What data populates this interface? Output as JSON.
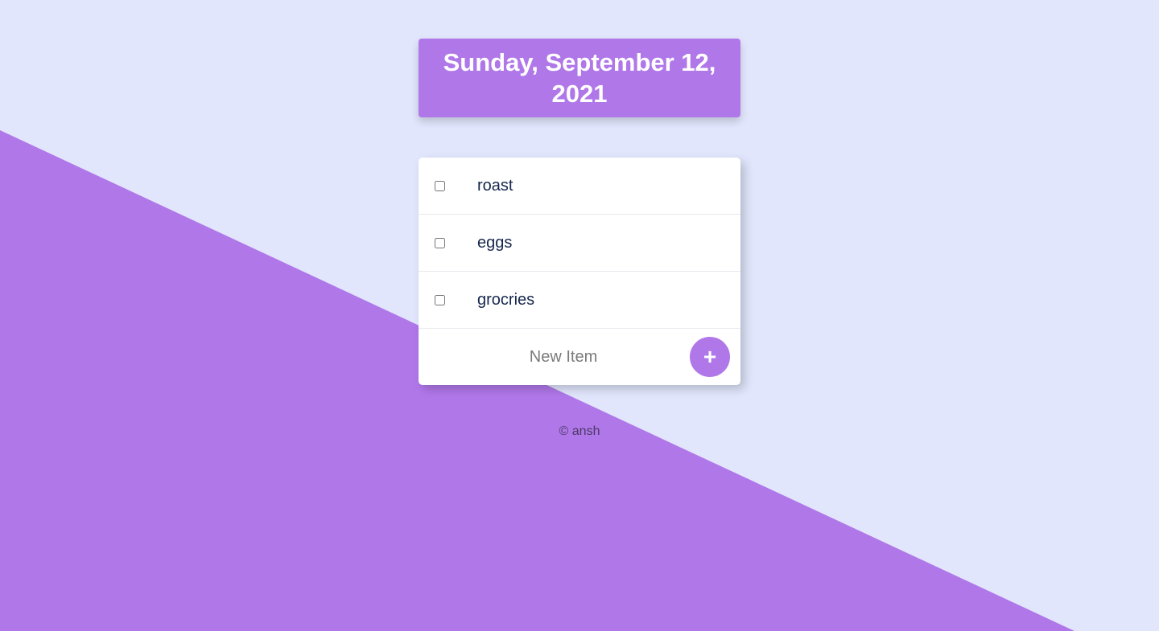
{
  "header": {
    "title": "Sunday, September 12, 2021"
  },
  "todo": {
    "items": [
      {
        "label": "roast",
        "checked": false
      },
      {
        "label": "eggs",
        "checked": false
      },
      {
        "label": "grocries",
        "checked": false
      }
    ],
    "new_item_placeholder": "New Item",
    "add_button_label": "+"
  },
  "footer": {
    "text": "© ansh"
  },
  "colors": {
    "background": "#E1E6FC",
    "accent": "#B077E9",
    "item_text": "#15264D"
  }
}
